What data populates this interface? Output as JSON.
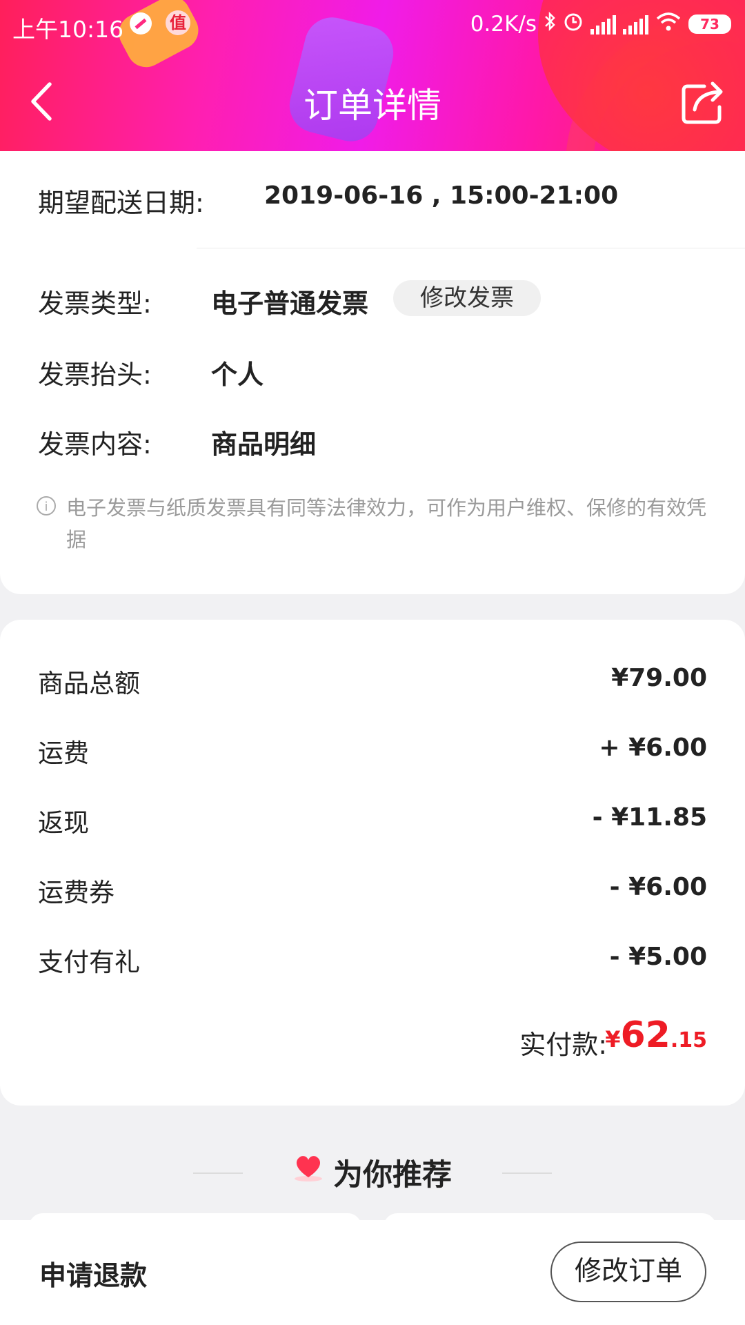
{
  "status_bar": {
    "time": "上午10:16",
    "badge": "值",
    "net_speed": "0.2K/s",
    "battery": "73"
  },
  "header": {
    "title": "订单详情"
  },
  "delivery": {
    "label": "期望配送日期:",
    "value": "2019-06-16 , 15:00-21:00"
  },
  "invoice": {
    "type_label": "发票类型:",
    "type_value": "电子普通发票",
    "edit_label": "修改发票",
    "title_label": "发票抬头:",
    "title_value": "个人",
    "content_label": "发票内容:",
    "content_value": "商品明细",
    "note_icon": "info-icon",
    "note": "电子发票与纸质发票具有同等法律效力，可作为用户维权、保修的有效凭据"
  },
  "amounts": {
    "items": [
      {
        "label": "商品总额",
        "value": "¥79.00"
      },
      {
        "label": "运费",
        "value": "+ ¥6.00"
      },
      {
        "label": "返现",
        "value": "- ¥11.85"
      },
      {
        "label": "运费券",
        "value": "- ¥6.00"
      },
      {
        "label": "支付有礼",
        "value": "- ¥5.00"
      }
    ],
    "total_label": "实付款:",
    "total_symbol": "¥",
    "total_integer": "62",
    "total_decimal": ".15",
    "total_color": "#ee1c25"
  },
  "recommend": {
    "title": "为你推荐",
    "icon": "heart-icon"
  },
  "bottom_bar": {
    "refund_label": "申请退款",
    "modify_label": "修改订单"
  }
}
